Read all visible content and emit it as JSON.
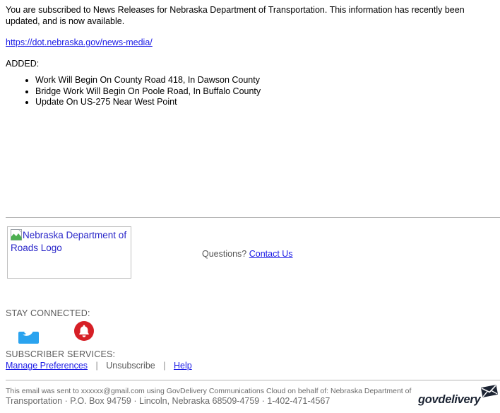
{
  "message": {
    "intro": "You are subscribed to News Releases for Nebraska Department of Transportation. This information has recently been updated, and is now available.",
    "link_text": "https://dot.nebraska.gov/news-media/",
    "added_label": "ADDED:",
    "added_items": [
      "Work Will Begin On County Road 418, In Dawson County",
      "Bridge Work Will Begin On Poole Road, In Buffalo County",
      "Update On US-275 Near West Point"
    ]
  },
  "brand": {
    "logo_alt": "Nebraska Department of Roads Logo",
    "questions_label": "Questions?",
    "contact_link": "Contact Us"
  },
  "stay_connected": {
    "label": "STAY CONNECTED:",
    "icons": [
      {
        "name": "twitter-icon",
        "color": "#2aa3ef"
      },
      {
        "name": "bell-subscribe-icon",
        "color": "#d61f26"
      }
    ]
  },
  "subscriber_services": {
    "label": "SUBSCRIBER SERVICES:",
    "manage_preferences": "Manage Preferences",
    "separator": "|",
    "unsubscribe": "Unsubscribe",
    "help": "Help"
  },
  "legal": {
    "line1": "This email was sent to xxxxxx@gmail.com using GovDelivery Communications Cloud on behalf of: Nebraska Department of",
    "line2": "Transportation · P.O. Box 94759 · Lincoln, Nebraska 68509-4759 · 1-402-471-4567"
  },
  "govdelivery": {
    "wordmark": "govdelivery",
    "wordmark_color": "#1c2433"
  },
  "colors": {
    "link_blue": "#1a1ae6",
    "alt_text_blue": "#2a27c9",
    "muted_gray": "#5a5a5a",
    "divider_gray": "#b4b4b4",
    "twitter_blue": "#2aa3ef",
    "bell_red": "#d61f26"
  }
}
